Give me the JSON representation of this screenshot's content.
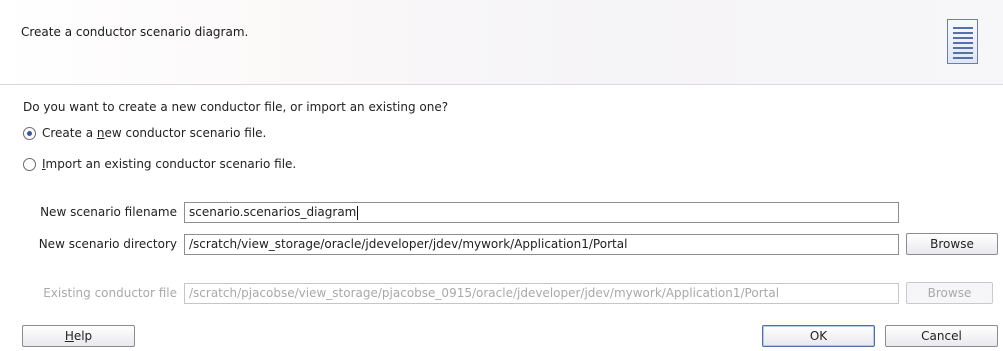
{
  "header": {
    "title": "Create a conductor scenario diagram."
  },
  "icons": {
    "header": "document-list-icon",
    "radio": "radio-icon"
  },
  "question": "Do you want to create a new conductor file, or import an existing one?",
  "options": [
    {
      "before": "Create a ",
      "mnemonic": "n",
      "after": "ew conductor scenario file.",
      "selected": true
    },
    {
      "before": "",
      "mnemonic": "I",
      "after": "mport an existing conductor scenario file.",
      "selected": false
    }
  ],
  "fields": {
    "filename": {
      "label": "New scenario filename",
      "value": "scenario.scenarios_diagram"
    },
    "directory": {
      "label": "New scenario directory",
      "value": "/scratch/view_storage/oracle/jdeveloper/jdev/mywork/Application1/Portal"
    },
    "existing": {
      "label": "Existing conductor file",
      "value": "/scratch/pjacobse/view_storage/pjacobse_0915/oracle/jdeveloper/jdev/mywork/Application1/Portal",
      "disabled": true
    }
  },
  "buttons": {
    "browse_directory": "Browse",
    "browse_existing": "Browse",
    "help_mnemonic": "H",
    "help_rest": "elp",
    "ok": "OK",
    "cancel": "Cancel"
  },
  "colors": {
    "accent": "#3b55a6",
    "disabled_text": "#a9a9a9"
  }
}
